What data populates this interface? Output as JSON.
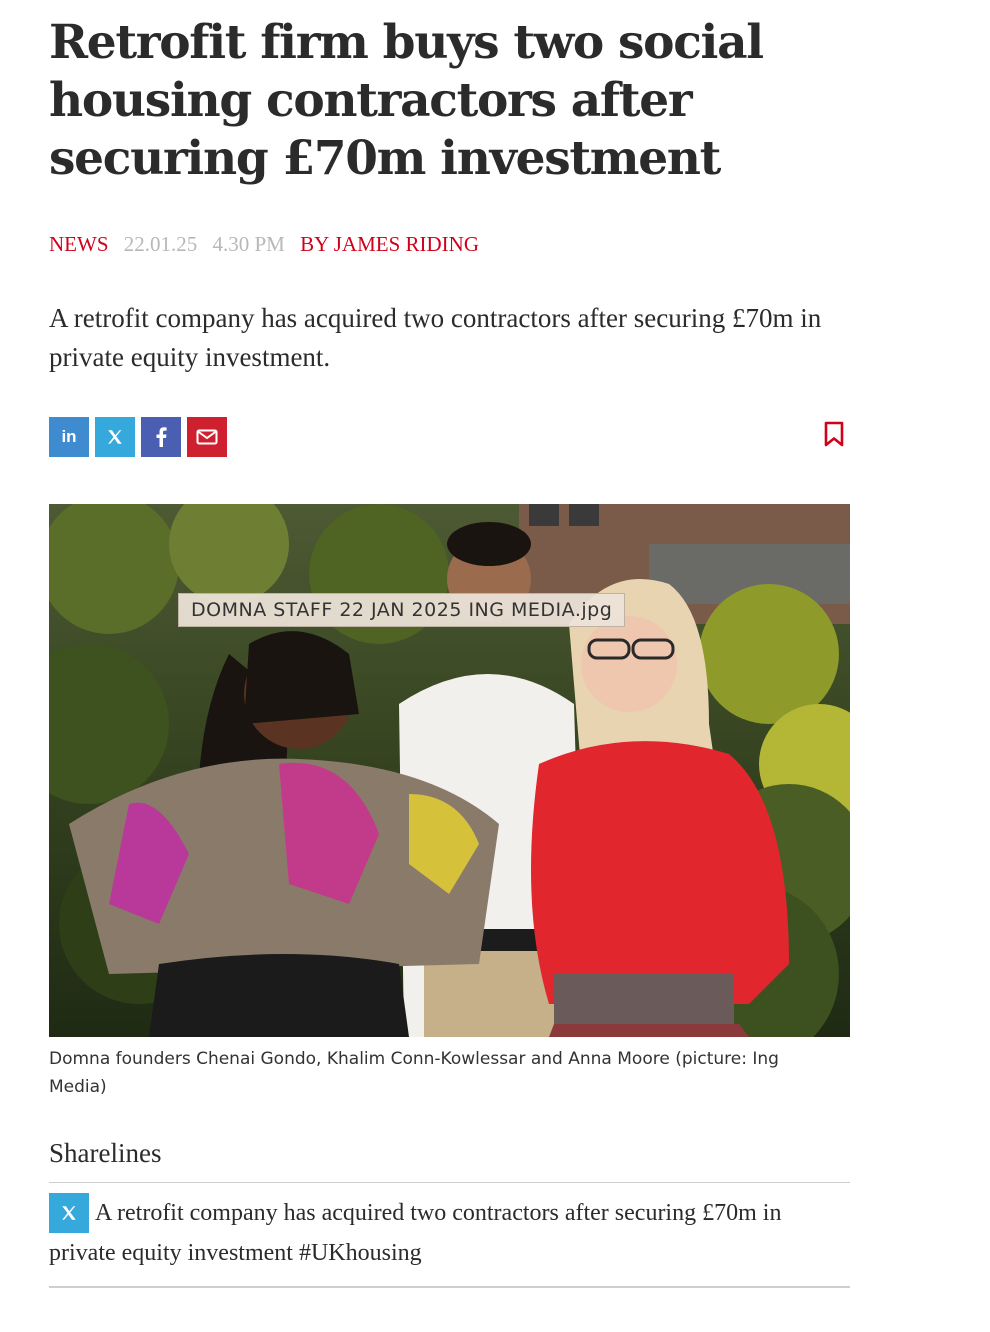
{
  "article": {
    "headline": "Retrofit firm buys two social housing contractors after securing £70m investment",
    "section": "NEWS",
    "date": "22.01.25",
    "time": "4.30 PM",
    "byline": "BY JAMES RIDING",
    "standfirst": "A retrofit company has acquired two contractors after securing £70m in private equity investment."
  },
  "share": {
    "linkedin_label": "in",
    "icons": [
      "linkedin-icon",
      "x-icon",
      "facebook-icon",
      "email-icon",
      "bookmark-icon"
    ]
  },
  "image": {
    "tooltip": "DOMNA STAFF 22 JAN 2025 ING MEDIA.jpg",
    "caption": "Domna founders Chenai Gondo, Khalim Conn-Kowlessar and Anna Moore (picture: Ing Media)"
  },
  "sharelines": {
    "title": "Sharelines",
    "text": "A retrofit company has acquired two contractors after securing £70m in private equity investment #UKhousing"
  },
  "colors": {
    "accent_red": "#d0021b",
    "meta_grey": "#b8b8b8",
    "linkedin": "#3f8bd0",
    "x": "#35a8dc",
    "facebook": "#4a5fb2",
    "email": "#cf2030"
  }
}
